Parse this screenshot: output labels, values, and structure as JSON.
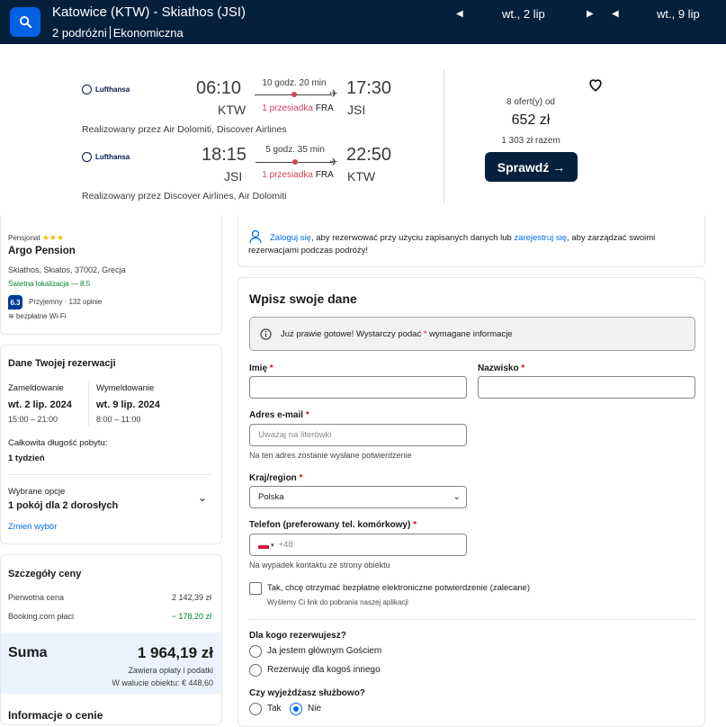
{
  "topbar": {
    "route": "Katowice (KTW) - Skiathos (JSI)",
    "travellers": "2 podróżni",
    "cabin": "Ekonomiczna",
    "depart_date": "wt., 2 lip",
    "return_date": "wt., 9 lip",
    "prev_icon": "triangle-left",
    "next_icon": "triangle-right"
  },
  "flight": {
    "outbound": {
      "airline": "Lufthansa",
      "dep_time": "06:10",
      "arr_time": "17:30",
      "dep_airport": "KTW",
      "arr_airport": "JSI",
      "duration": "10 godz. 20 min",
      "stops": "1 przesiadka",
      "via": "FRA",
      "operated": "Realizowany przez Air Dolomiti, Discover Airlines"
    },
    "inbound": {
      "airline": "Lufthansa",
      "dep_time": "18:15",
      "arr_time": "22:50",
      "dep_airport": "JSI",
      "arr_airport": "KTW",
      "duration": "5 godz. 35 min",
      "stops": "1 przesiadka",
      "via": "FRA",
      "operated": "Realizowany przez Discover Airlines, Air Dolomiti"
    },
    "offers": "8 ofert(y) od",
    "price": "652 zł",
    "total": "1 303 zł razem",
    "check_label": "Sprawdź →"
  },
  "hotel": {
    "type": "Pensjonat",
    "stars": "★★★",
    "name": "Argo Pension",
    "address": "Skiathos, Skiatos, 37002, Grecja",
    "location": "Świetna lokalizacja — 8.5",
    "score": "6.3",
    "score_text": "Przyjemny · 132 opinie",
    "wifi": "bezpłatne Wi-Fi"
  },
  "booking": {
    "title": "Dane Twojej rezerwacji",
    "checkin_label": "Zameldowanie",
    "checkin_date": "wt. 2 lip. 2024",
    "checkin_time": "15:00 – 21:00",
    "checkout_label": "Wymeldowanie",
    "checkout_date": "wt. 9 lip. 2024",
    "checkout_time": "8:00 – 11:00",
    "stay_label": "Całkowita długość pobytu:",
    "stay_value": "1 tydzień",
    "options_label": "Wybrane opcje",
    "options_value": "1 pokój dla 2 dorosłych",
    "change_link": "Zmień wybór"
  },
  "price_details": {
    "title": "Szczegóły ceny",
    "original_label": "Pierwotna cena",
    "original_value": "2 142,39 zł",
    "discount_label": "Booking.com płaci",
    "discount_value": "− 178,20 zł",
    "sum_label": "Suma",
    "sum_value": "1 964,19 zł",
    "sum_note": "Zawiera opłaty i podatki",
    "sum_local": "W walucie obiektu: € 448,60",
    "next_heading": "Informacje o cenie"
  },
  "login": {
    "link": "Zaloguj się",
    "text1": ", aby rezerwować przy użyciu zapisanych danych lub ",
    "register": "zarejestruj się",
    "text2": ", aby zarządzać swoimi",
    "text3": "rezerwacjami podczas podróży!"
  },
  "form": {
    "title": "Wpisz swoje dane",
    "notice_pre": "Już prawie gotowe! Wystarczy podać ",
    "notice_star": "*",
    "notice_post": " wymagane informacje",
    "first_name": "Imię",
    "last_name": "Nazwisko",
    "email": "Adres e-mail",
    "email_placeholder": "Uważaj na literówki",
    "email_hint": "Na ten adres zostanie wysłane potwierdzenie",
    "country": "Kraj/region",
    "country_value": "Polska",
    "phone": "Telefon (preferowany tel. komórkowy)",
    "phone_prefix": "+48",
    "phone_hint": "Na wypadek kontaktu ze strony obiektu",
    "confirm_check": "Tak, chcę otrzymać bezpłatne elektroniczne potwierdzenie (zalecane)",
    "confirm_hint": "Wyślemy Ci link do pobrania naszej aplikacji",
    "for_whom": "Dla kogo rezerwujesz?",
    "opt_main": "Ja jestem głównym Gościem",
    "opt_other": "Rezerwuję dla kogoś innego",
    "business": "Czy wyjeżdżasz służbowo?",
    "yes": "Tak",
    "no": "Nie",
    "req": "*"
  }
}
